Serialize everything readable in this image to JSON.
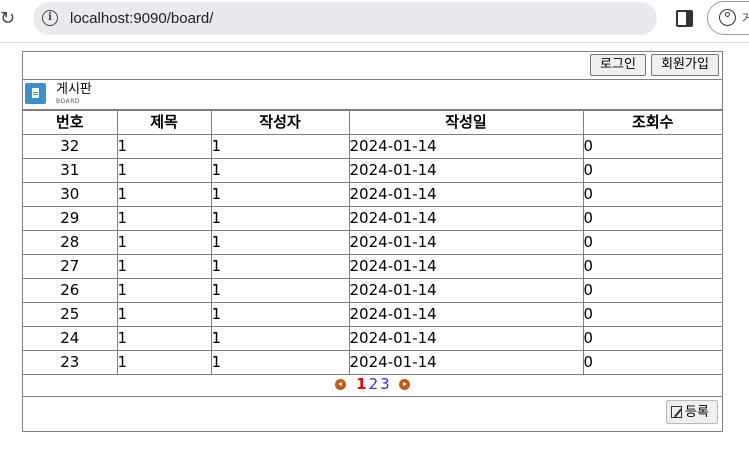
{
  "browser": {
    "url": "localhost:9090/board/",
    "profile_label": "게"
  },
  "board": {
    "login_label": "로그인",
    "signup_label": "회원가입",
    "title": "게시판",
    "subtitle": "BOARD",
    "columns": [
      "번호",
      "제목",
      "작성자",
      "작성일",
      "조회수"
    ],
    "rows": [
      {
        "no": "32",
        "title": "1",
        "writer": "1",
        "date": "2024-01-14",
        "views": "0"
      },
      {
        "no": "31",
        "title": "1",
        "writer": "1",
        "date": "2024-01-14",
        "views": "0"
      },
      {
        "no": "30",
        "title": "1",
        "writer": "1",
        "date": "2024-01-14",
        "views": "0"
      },
      {
        "no": "29",
        "title": "1",
        "writer": "1",
        "date": "2024-01-14",
        "views": "0"
      },
      {
        "no": "28",
        "title": "1",
        "writer": "1",
        "date": "2024-01-14",
        "views": "0"
      },
      {
        "no": "27",
        "title": "1",
        "writer": "1",
        "date": "2024-01-14",
        "views": "0"
      },
      {
        "no": "26",
        "title": "1",
        "writer": "1",
        "date": "2024-01-14",
        "views": "0"
      },
      {
        "no": "25",
        "title": "1",
        "writer": "1",
        "date": "2024-01-14",
        "views": "0"
      },
      {
        "no": "24",
        "title": "1",
        "writer": "1",
        "date": "2024-01-14",
        "views": "0"
      },
      {
        "no": "23",
        "title": "1",
        "writer": "1",
        "date": "2024-01-14",
        "views": "0"
      }
    ],
    "pagination": {
      "pages": [
        "1",
        "2",
        "3"
      ],
      "current_page": "1"
    },
    "register_label": "등록"
  },
  "icons": {
    "reload": "reload-icon",
    "site_info": "info-icon",
    "side_panel": "side-panel-icon",
    "profile": "profile-icon",
    "board": "document-icon",
    "prev": "prev-arrow-icon",
    "next": "next-arrow-icon",
    "register": "edit-icon"
  },
  "colors": {
    "board_icon": "#3c8fc9",
    "arrow": "#c0581b",
    "current_page": "#e00000",
    "page_link": "#3333cc"
  }
}
